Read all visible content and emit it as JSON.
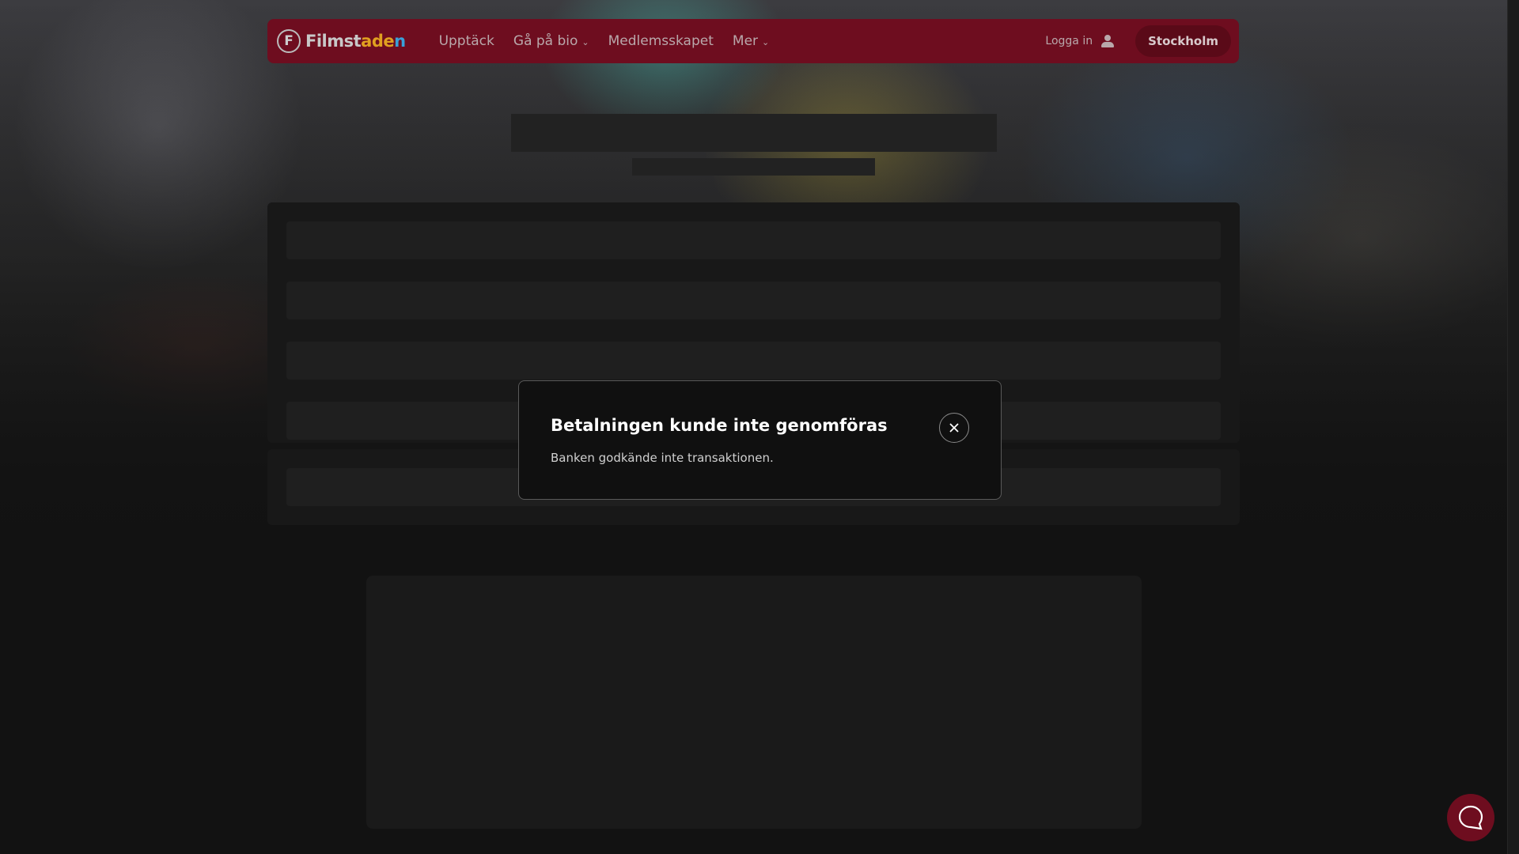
{
  "nav": {
    "logo": {
      "part1": "Filmst",
      "part2": "ade",
      "part3": "n"
    },
    "links": [
      {
        "label": "Upptäck",
        "has_dropdown": false
      },
      {
        "label": "Gå på bio",
        "has_dropdown": true
      },
      {
        "label": "Medlemsskapet",
        "has_dropdown": false
      },
      {
        "label": "Mer",
        "has_dropdown": true
      }
    ],
    "login_label": "Logga in",
    "city_label": "Stockholm"
  },
  "modal": {
    "title": "Betalningen kunde inte genomföras",
    "message": "Banken godkände inte transaktionen."
  },
  "icons": {
    "user": "user-icon",
    "close": "close-icon",
    "chat": "chat-icon",
    "chevron": "chevron-down-icon"
  },
  "colors": {
    "brand": "#6e0d1f",
    "background": "#121212"
  }
}
